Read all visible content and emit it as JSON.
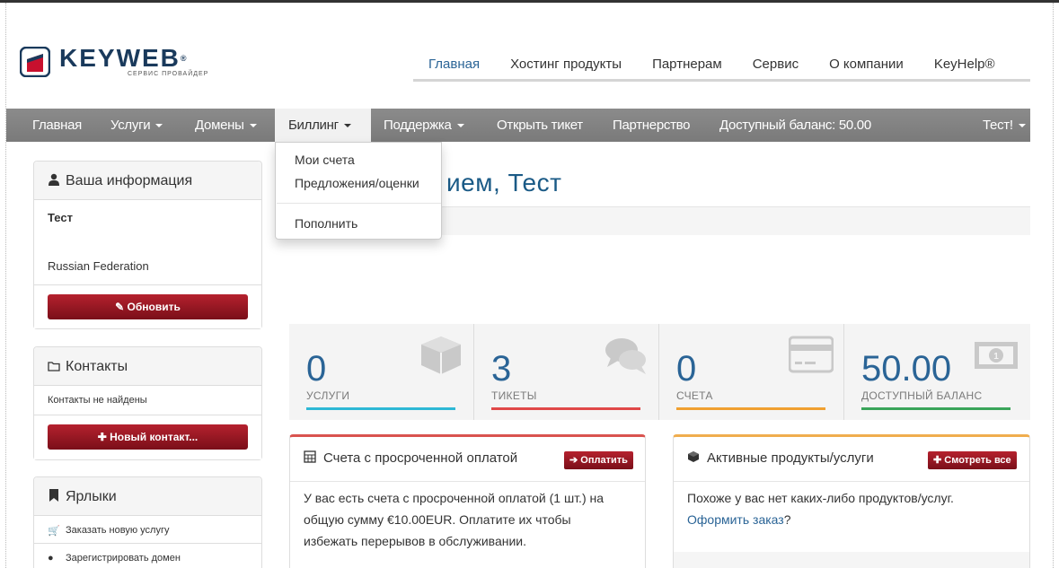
{
  "brand": {
    "name": "KEYWEB",
    "reg": "®",
    "subtitle": "СЕРВИС  ПРОВАЙДЕР"
  },
  "topnav": {
    "items": [
      {
        "label": "Главная"
      },
      {
        "label": "Хостинг продукты"
      },
      {
        "label": "Партнерам"
      },
      {
        "label": "Сервис"
      },
      {
        "label": "О компании"
      },
      {
        "label": "KeyHelp®"
      }
    ]
  },
  "navbar": {
    "home": "Главная",
    "services": "Услуги",
    "domains": "Домены",
    "billing": "Биллинг",
    "support": "Поддержка",
    "open_ticket": "Открыть тикет",
    "partnership": "Партнерство",
    "balance": "Доступный баланс: 50.00",
    "user": "Тест!"
  },
  "billing_menu": {
    "items": [
      "Мои счета",
      "Предложения/оценки",
      "Пополнить"
    ]
  },
  "sidebar": {
    "info": {
      "title": "Ваша информация",
      "name": "Тест",
      "country": "Russian Federation",
      "update_button": "Обновить"
    },
    "contacts": {
      "title": "Контакты",
      "empty": "Контакты не найдены",
      "new_button": "Новый контакт..."
    },
    "shortcuts": {
      "title": "Ярлыки",
      "items": [
        "Заказать новую услугу",
        "Зарегистрировать домен"
      ]
    }
  },
  "main": {
    "title": "ием, Тест",
    "tiles": [
      {
        "value": "0",
        "label": "УСЛУГИ",
        "color": "#2db8d5"
      },
      {
        "value": "3",
        "label": "ТИКЕТЫ",
        "color": "#e04848"
      },
      {
        "value": "0",
        "label": "СЧЕТА",
        "color": "#f0a030"
      },
      {
        "value": "50.00",
        "label": "ДОСТУПНЫЙ БАЛАНС",
        "color": "#3aa55a"
      }
    ],
    "overdue": {
      "title": "Счета с просроченной оплатой",
      "button": "Оплатить",
      "text_lines": [
        "У вас есть счета с просроченной оплатой (1 шт.) на",
        "общую сумму €10.00EUR. Оплатите их чтобы",
        "избежать перерывов в обслуживании."
      ],
      "accent": "#d9534f"
    },
    "active": {
      "title": "Активные продукты/услуги",
      "button": "Смотреть все",
      "text": "Похоже у вас нет каких-либо продуктов/услуг.",
      "link": "Оформить заказ",
      "link_suffix": "?",
      "accent": "#f0ad4e"
    }
  }
}
